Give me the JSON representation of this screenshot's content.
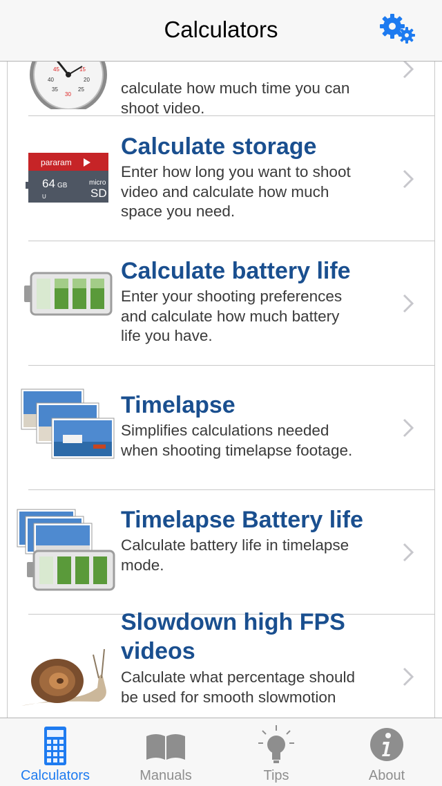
{
  "navbar": {
    "title": "Calculators",
    "settings_icon": "gear-icon"
  },
  "rows": [
    {
      "title": "",
      "description": "calculate how much time you can\nshoot video.",
      "icon": "stopwatch-icon"
    },
    {
      "title": "Calculate storage",
      "description": "Enter how long you want to shoot\nvideo and calculate how much\nspace you need.",
      "icon": "sd-card-icon",
      "card": {
        "brand": "pararam",
        "capacity": "64",
        "unit": "GB",
        "type_top": "micro",
        "type_bottom": "SD",
        "class_mark": "U"
      }
    },
    {
      "title": "Calculate battery life",
      "description": "Enter your shooting preferences\nand calculate how much battery\nlife you have.",
      "icon": "battery-icon"
    },
    {
      "title": "Timelapse",
      "description": "Simplifies calculations needed\nwhen shooting timelapse footage.",
      "icon": "photo-stack-icon"
    },
    {
      "title": "Timelapse Battery life",
      "description": "Calculate battery life in timelapse\nmode.",
      "icon": "photo-battery-icon"
    },
    {
      "title": "Slowdown high FPS\nvideos",
      "description": "Calculate what percentage should\nbe used for smooth slowmotion",
      "icon": "snail-icon"
    }
  ],
  "stopwatch_numbers": [
    "45",
    "40",
    "35",
    "30",
    "25",
    "20",
    "15"
  ],
  "tabbar": {
    "tabs": [
      {
        "label": "Calculators",
        "icon": "calculator-icon",
        "active": true
      },
      {
        "label": "Manuals",
        "icon": "book-icon",
        "active": false
      },
      {
        "label": "Tips",
        "icon": "lightbulb-icon",
        "active": false
      },
      {
        "label": "About",
        "icon": "info-icon",
        "active": false
      }
    ]
  },
  "colors": {
    "accent": "#1e7bf0",
    "title_blue": "#1a4f8f",
    "inactive": "#8e8e8e"
  }
}
